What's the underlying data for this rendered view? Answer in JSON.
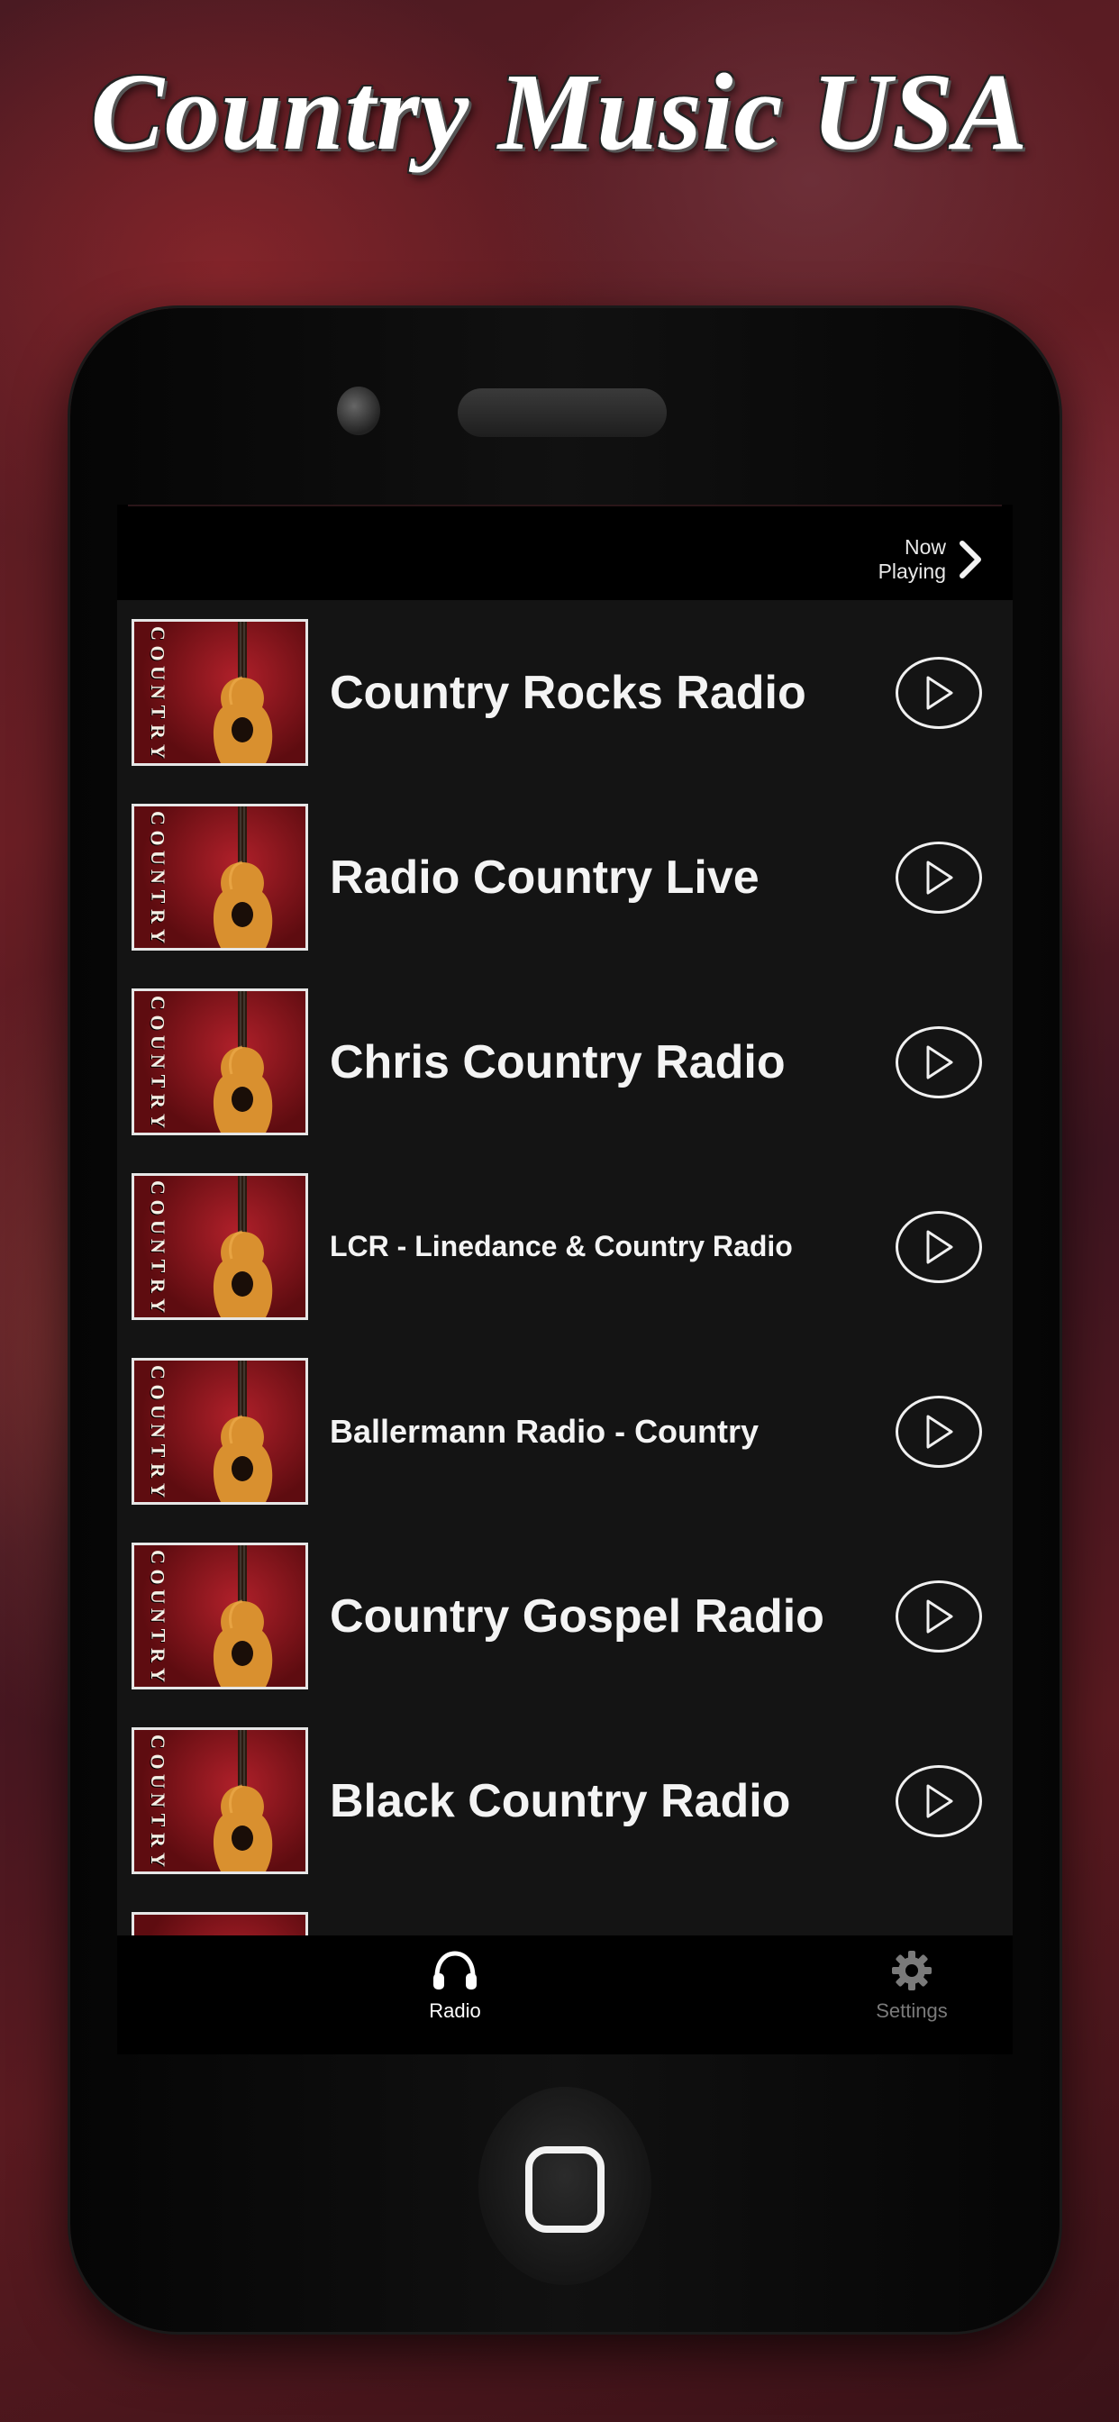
{
  "headline": "Country Music USA",
  "header": {
    "now_playing_line1": "Now",
    "now_playing_line2": "Playing"
  },
  "thumbnail_text": "COUNTRY",
  "stations": [
    {
      "name": "Country Rocks Radio"
    },
    {
      "name": "Radio Country Live"
    },
    {
      "name": "Chris Country Radio"
    },
    {
      "name": "LCR - Linedance & Country Radio"
    },
    {
      "name": "Ballermann Radio - Country"
    },
    {
      "name": "Country Gospel Radio"
    },
    {
      "name": "Black Country Radio"
    }
  ],
  "tabs": [
    {
      "label": "Radio",
      "icon": "headphones-icon",
      "active": true
    },
    {
      "label": "Settings",
      "icon": "gear-icon",
      "active": false
    }
  ],
  "colors": {
    "list_background": "#141414",
    "text": "#f4f4f4",
    "tab_active": "#ffffff",
    "tab_inactive": "#7a7a7a"
  }
}
